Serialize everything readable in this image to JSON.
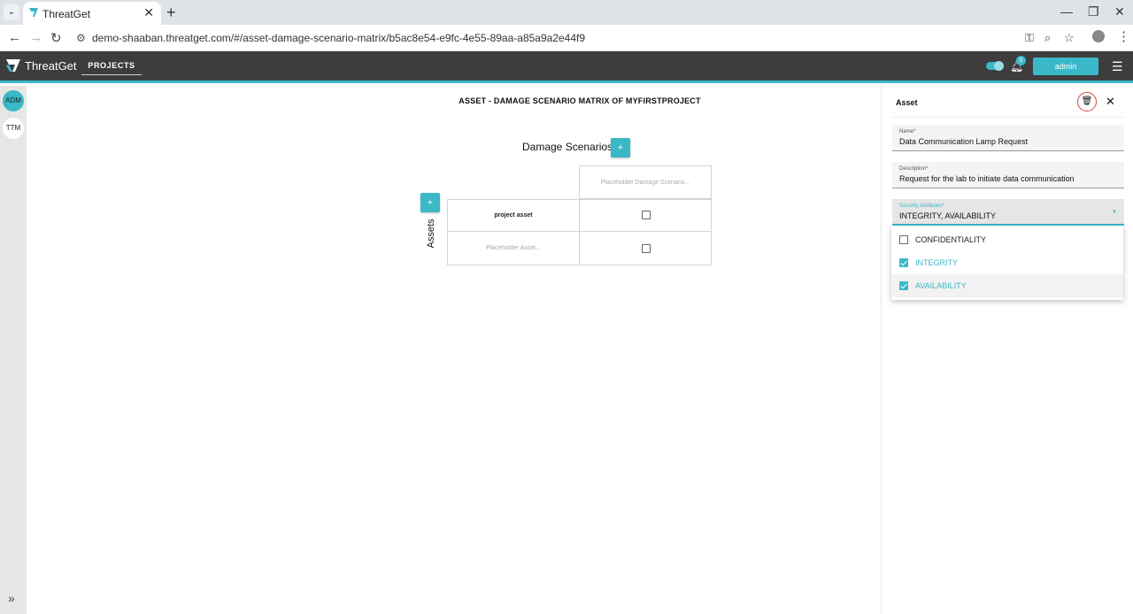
{
  "browser": {
    "tab_title": "ThreatGet",
    "url": "demo-shaaban.threatget.com/#/asset-damage-scenario-matrix/b5ac8e54-e9fc-4e55-89aa-a85a9a2e44f9"
  },
  "header": {
    "logo": "ThreatGet",
    "nav_projects": "PROJECTS",
    "notification_count": "0",
    "user_button": "admin"
  },
  "rail": {
    "items": [
      "ADM",
      "TTM"
    ]
  },
  "matrix": {
    "title": "ASSET - DAMAGE SCENARIO MATRIX OF MYFIRSTPROJECT",
    "damage_scenarios_label": "Damage Scenarios",
    "assets_label": "Assets",
    "add_label": "+",
    "column_header": "Placeholder Damage Scenario...",
    "rows": [
      {
        "asset": "project asset",
        "checked": false
      },
      {
        "asset": "Placeholder Asset...",
        "checked": false
      }
    ]
  },
  "panel": {
    "title": "Asset",
    "name_label": "Name*",
    "name_value": "Data Communication Lamp Request",
    "description_label": "Description*",
    "description_value": "Request for the lab to initiate data communication",
    "security_label": "Security Attributes*",
    "security_value": "INTEGRITY, AVAILABILITY",
    "options": [
      {
        "label": "CONFIDENTIALITY",
        "checked": false
      },
      {
        "label": "INTEGRITY",
        "checked": true
      },
      {
        "label": "AVAILABILITY",
        "checked": true
      }
    ]
  },
  "colors": {
    "accent": "#3ab8c8",
    "appbar": "#3d3d3d",
    "danger": "#e04040"
  }
}
